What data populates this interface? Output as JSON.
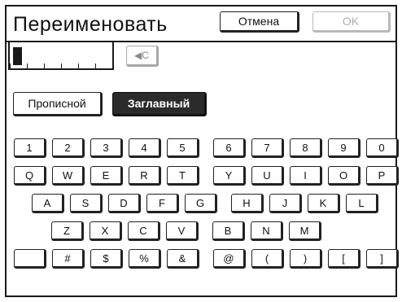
{
  "dialog": {
    "title": "Переименовать",
    "cancel_label": "Отмена",
    "ok_label": "OK"
  },
  "input": {
    "value": "",
    "backspace_label": "◀C"
  },
  "case_buttons": {
    "lowercase_label": "Прописной",
    "uppercase_label": "Заглавный",
    "selected": "uppercase"
  },
  "keyboard": {
    "rows": [
      [
        "1",
        "2",
        "3",
        "4",
        "5",
        "6",
        "7",
        "8",
        "9",
        "0"
      ],
      [
        "Q",
        "W",
        "E",
        "R",
        "T",
        "Y",
        "U",
        "I",
        "O",
        "P"
      ],
      [
        "A",
        "S",
        "D",
        "F",
        "G",
        "H",
        "J",
        "K",
        "L"
      ],
      [
        "Z",
        "X",
        "C",
        "V",
        "B",
        "N",
        "M"
      ],
      [
        "",
        "#",
        "$",
        "%",
        "&",
        "@",
        "(",
        ")",
        "[",
        "]"
      ]
    ]
  }
}
